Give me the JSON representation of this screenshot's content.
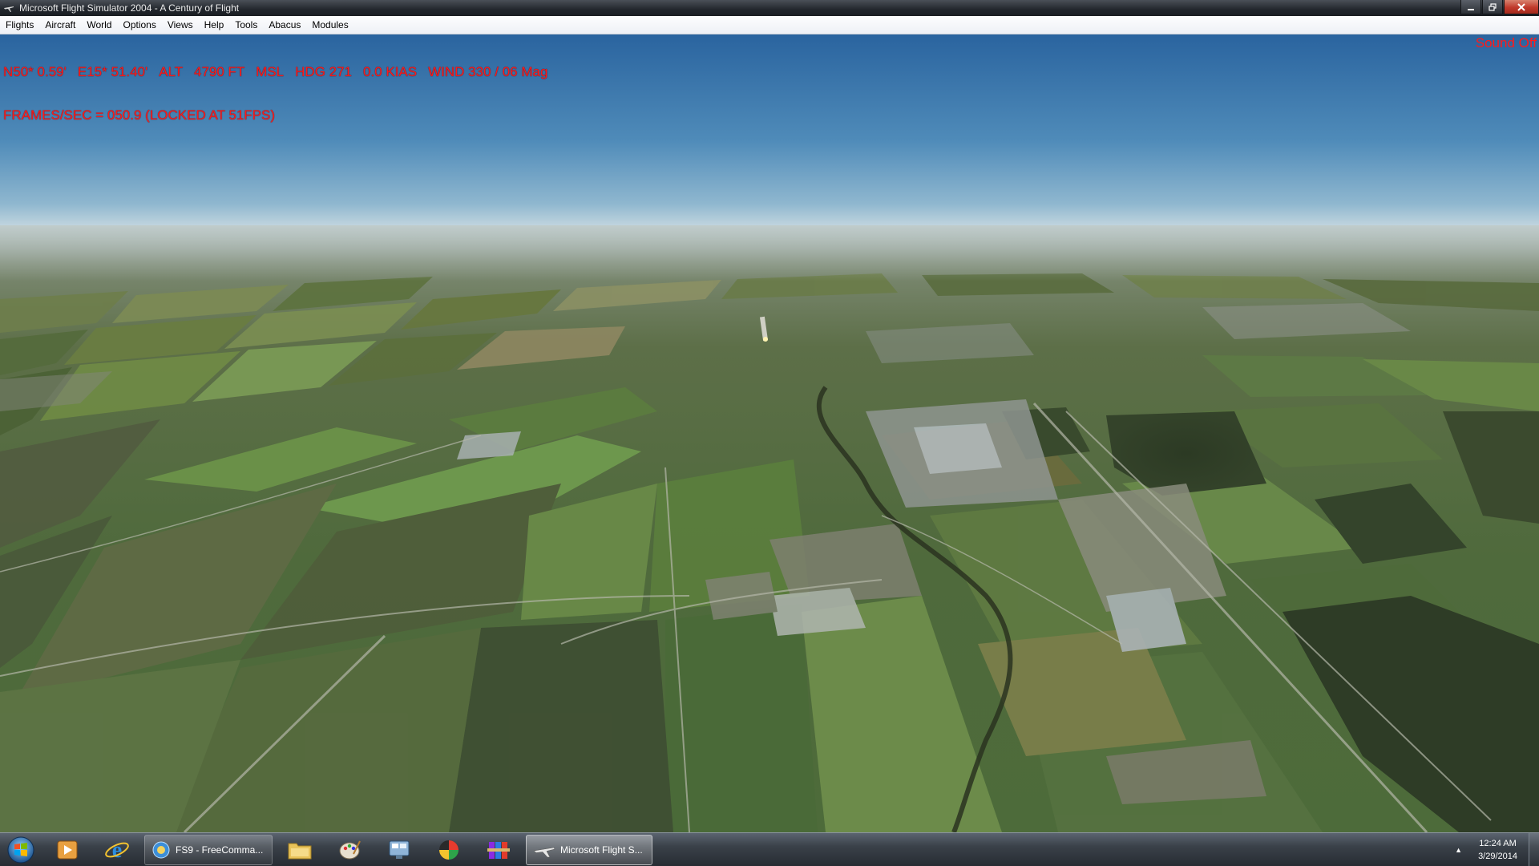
{
  "window": {
    "title": "Microsoft Flight Simulator 2004 - A Century of Flight",
    "icon": "airplane-icon"
  },
  "menu": {
    "items": [
      "Flights",
      "Aircraft",
      "World",
      "Options",
      "Views",
      "Help",
      "Tools",
      "Abacus",
      "Modules"
    ]
  },
  "hud": {
    "latitude": "N50* 0.59'",
    "longitude": "E15* 51.40'",
    "altitude": "ALT   4790 FT   MSL",
    "heading": "HDG 271",
    "airspeed": "0.0 KIAS",
    "wind": "WIND 330 / 06 Mag",
    "frames": "FRAMES/SEC = 050.9 (LOCKED AT 51FPS)",
    "sound": "Sound Off"
  },
  "colors": {
    "hud_text": "#ff1a1a",
    "sky_top": "#2f6aa3",
    "sky_horizon": "#b9d1df"
  },
  "taskbar": {
    "start": "windows-start-orb-icon",
    "pinned": [
      "media-player-icon",
      "internet-explorer-icon"
    ],
    "tasks": [
      {
        "label": "FS9 - FreeComma...",
        "icon": "fs9-globe-icon"
      },
      {
        "label": "Microsoft Flight S...",
        "icon": "airplane-icon"
      }
    ],
    "more_pinned": [
      "folder-icon",
      "paint-palette-icon",
      "control-panel-icon",
      "color-app-icon",
      "archive-books-icon"
    ],
    "clock": {
      "time": "12:24 AM",
      "date": "3/29/2014"
    }
  }
}
